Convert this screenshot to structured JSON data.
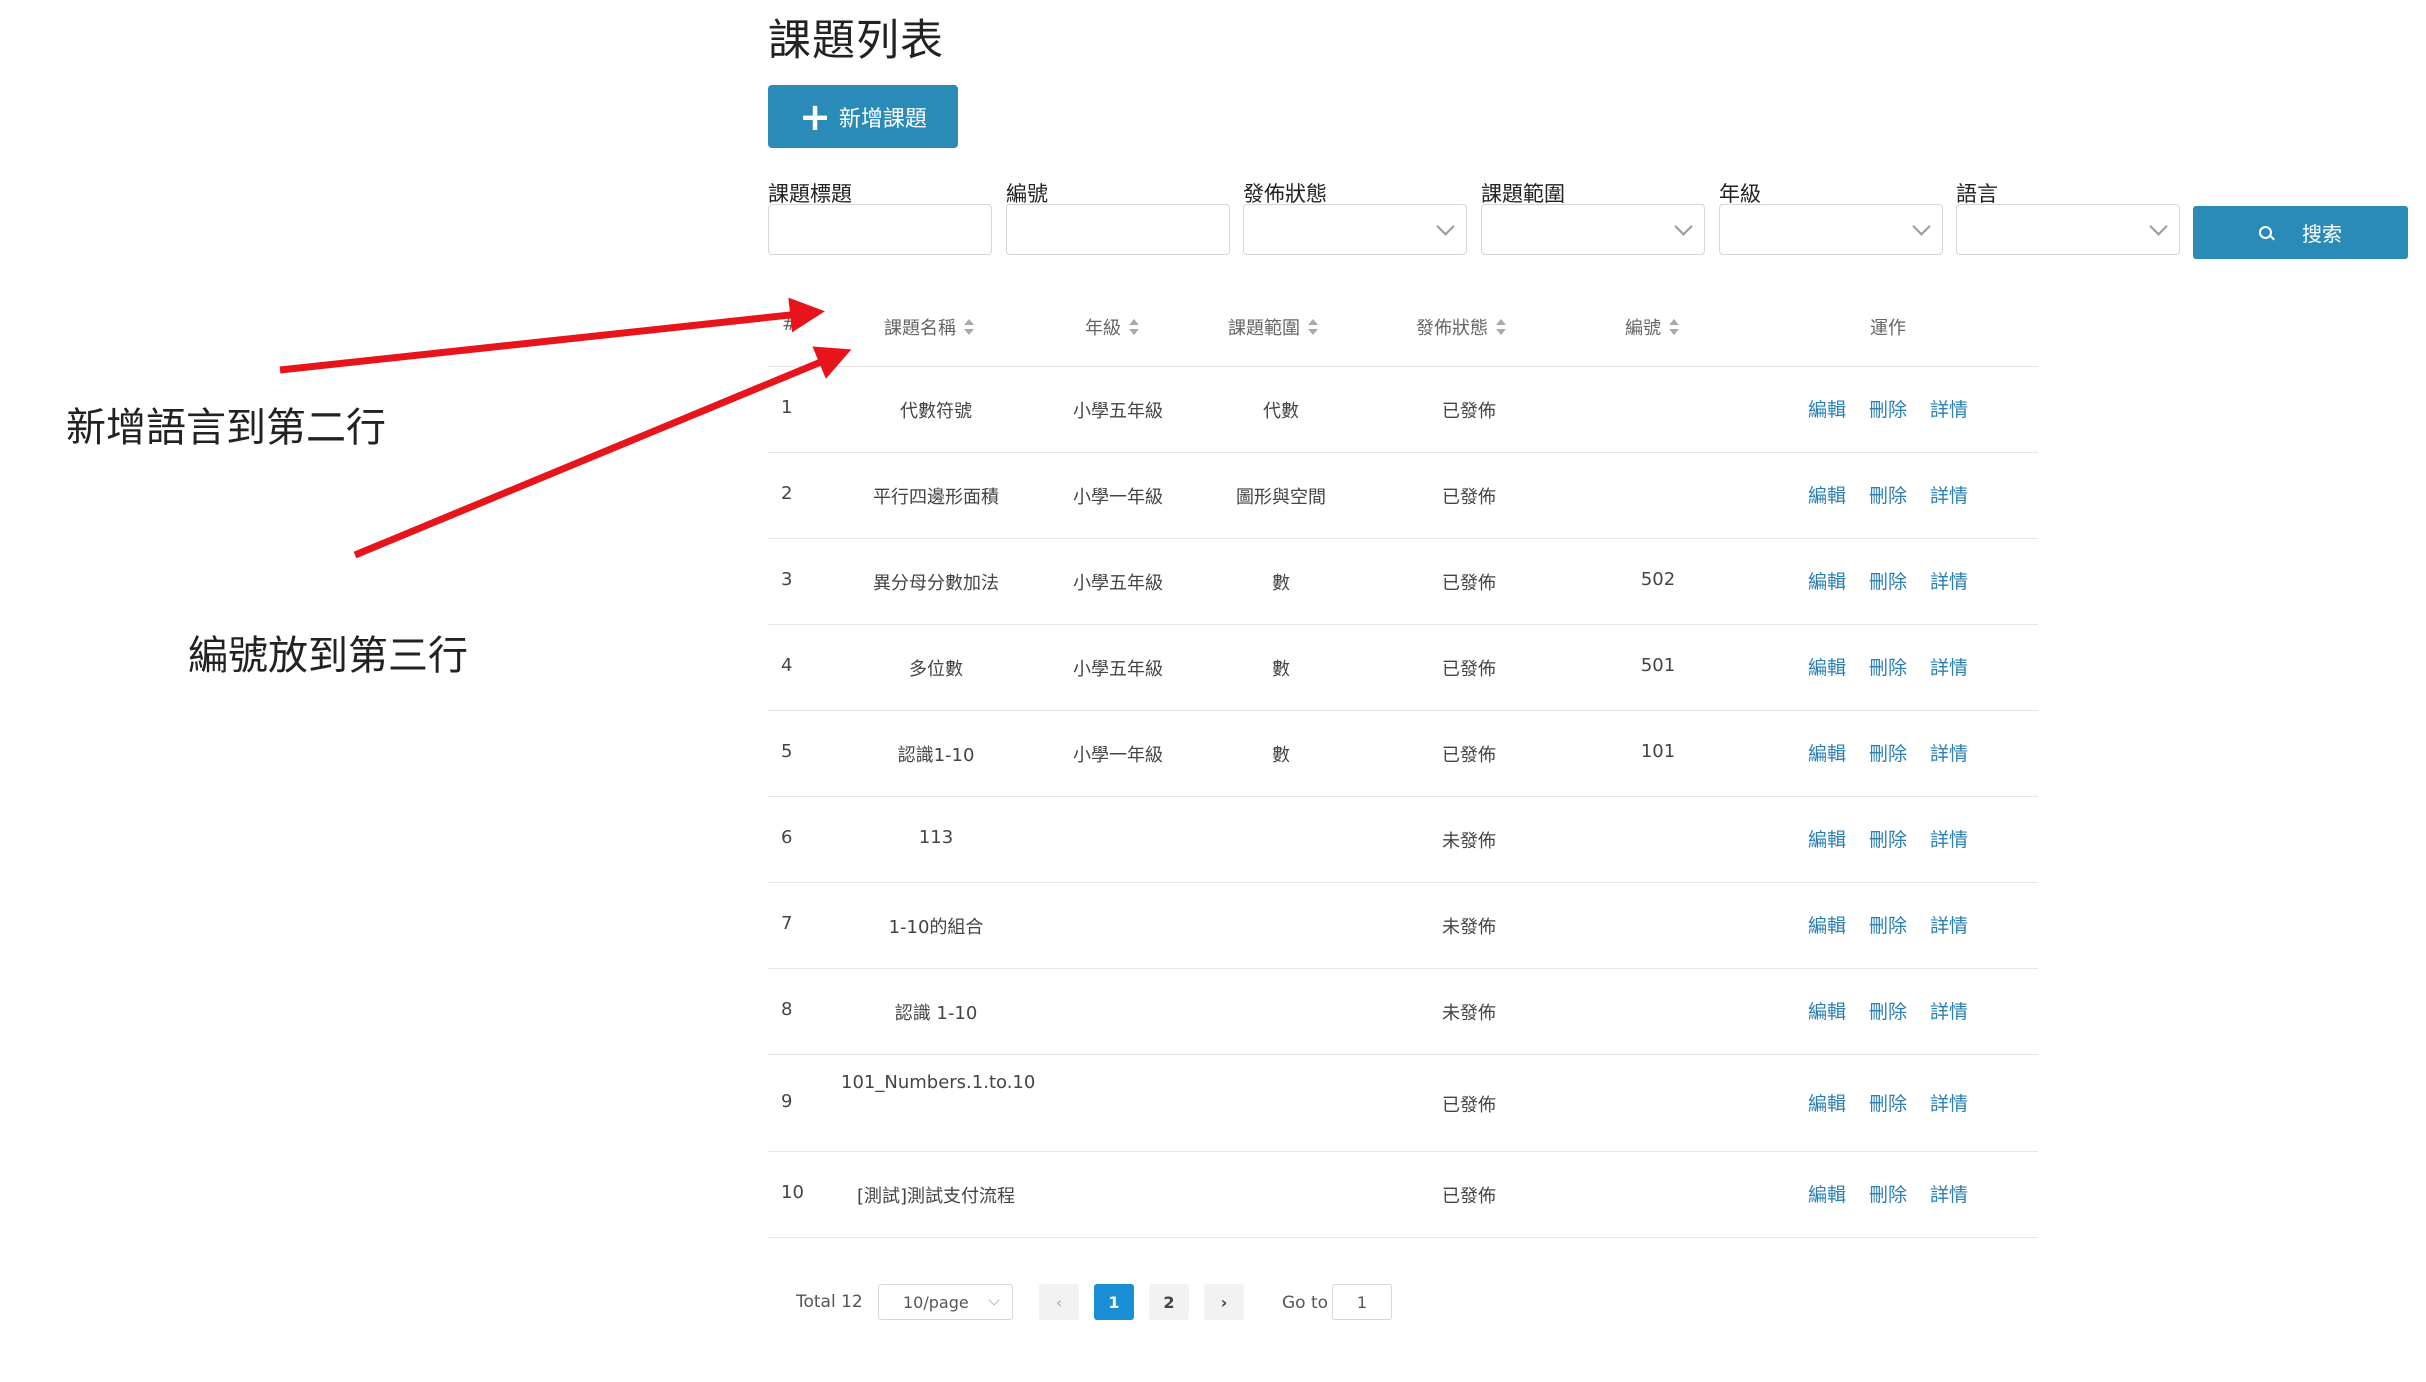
{
  "page": {
    "title": "課題列表",
    "add_button": "新增課題"
  },
  "filters": {
    "title_label": "課題標題",
    "number_label": "編號",
    "status_label": "發佈狀態",
    "scope_label": "課題範圍",
    "grade_label": "年級",
    "language_label": "語言",
    "search_button": "搜索"
  },
  "table": {
    "headers": {
      "index": "#",
      "name": "課題名稱",
      "grade": "年級",
      "scope": "課題範圍",
      "status": "發佈狀態",
      "number": "編號",
      "actions": "運作"
    },
    "actions": {
      "edit": "編輯",
      "delete": "刪除",
      "detail": "詳情"
    },
    "rows": [
      {
        "index": "1",
        "name": "代數符號",
        "grade": "小學五年級",
        "scope": "代數",
        "status": "已發佈",
        "number": ""
      },
      {
        "index": "2",
        "name": "平行四邊形面積",
        "grade": "小學一年級",
        "scope": "圖形與空間",
        "status": "已發佈",
        "number": ""
      },
      {
        "index": "3",
        "name": "異分母分數加法",
        "grade": "小學五年級",
        "scope": "數",
        "status": "已發佈",
        "number": "502"
      },
      {
        "index": "4",
        "name": "多位數",
        "grade": "小學五年級",
        "scope": "數",
        "status": "已發佈",
        "number": "501"
      },
      {
        "index": "5",
        "name": "認識1-10",
        "grade": "小學一年級",
        "scope": "數",
        "status": "已發佈",
        "number": "101"
      },
      {
        "index": "6",
        "name": "113",
        "grade": "",
        "scope": "",
        "status": "未發佈",
        "number": ""
      },
      {
        "index": "7",
        "name": "1-10的組合",
        "grade": "",
        "scope": "",
        "status": "未發佈",
        "number": ""
      },
      {
        "index": "8",
        "name": "認識 1-10",
        "grade": "",
        "scope": "",
        "status": "未發佈",
        "number": ""
      },
      {
        "index": "9",
        "name": "101_Numbers.1.to.10",
        "grade": "",
        "scope": "",
        "status": "已發佈",
        "number": ""
      },
      {
        "index": "10",
        "name": "[測試]測試支付流程",
        "grade": "",
        "scope": "",
        "status": "已發佈",
        "number": ""
      }
    ]
  },
  "pagination": {
    "total": "Total 12",
    "page_size": "10/page",
    "pages": [
      "1",
      "2"
    ],
    "current": "1",
    "goto_label": "Go to",
    "goto_value": "1"
  },
  "annotations": {
    "note1": "新增語言到第二行",
    "note2": "編號放到第三行"
  },
  "colors": {
    "accent": "#2a8ab8",
    "link": "#2a7fb5",
    "arrow": "#e8141c"
  }
}
